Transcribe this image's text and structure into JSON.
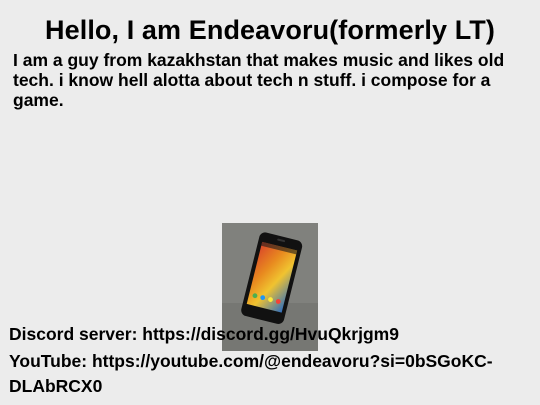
{
  "slide": {
    "title": "Hello, I am Endeavoru(formerly LT)",
    "bio_line1": "I am a guy from kazakhstan that makes music and likes old",
    "bio_line2": "tech. i know hell alotta about tech n stuff. i compose for a",
    "bio_line3": "game.",
    "discord_text": "Discord server: https://discord.gg/HvuQkrjgm9",
    "youtube_line1": "YouTube: https://youtube.com/@endeavoru?si=0bSGoKC-",
    "youtube_line2": "DLAbRCX0",
    "photo_icon": "smartphone-photo"
  },
  "colors": {
    "background": "#ececec",
    "text": "#000000"
  }
}
